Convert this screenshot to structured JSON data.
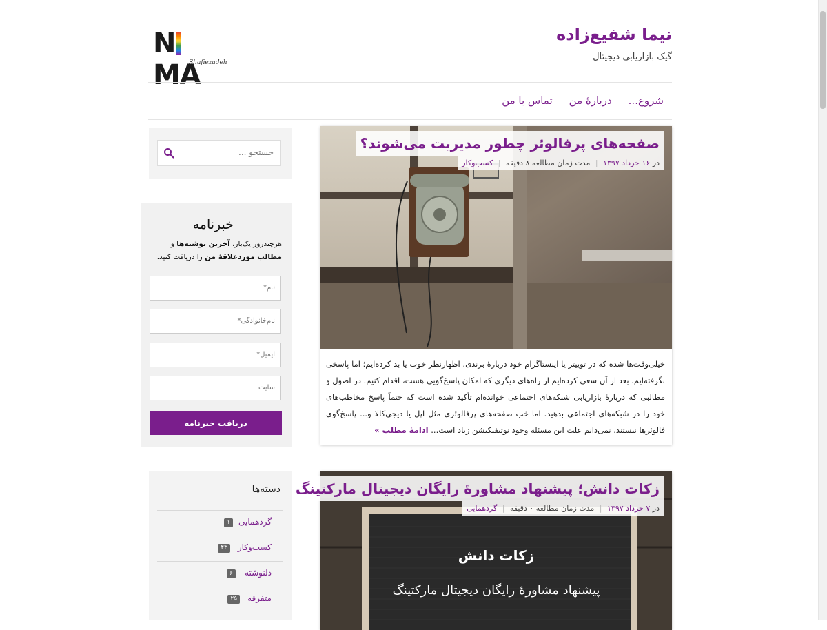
{
  "site": {
    "title": "نیما شفیع‌زاده",
    "tagline": "گیک بازاریابی دیجیتال",
    "logo_text": "NIMA",
    "logo_subtext": "Shafiezadeh"
  },
  "nav": {
    "items": [
      {
        "label": "شروع..."
      },
      {
        "label": "دربارهٔ من"
      },
      {
        "label": "تماس با من"
      }
    ]
  },
  "search": {
    "placeholder": "جستجو ..."
  },
  "newsletter": {
    "title": "خبرنامه",
    "text_before": "هرچندروز یک‌بار، ",
    "text_bold1": "آخرین نوشته‌ها",
    "text_mid": " و ",
    "text_bold2": "مطالب موردعلاقهٔ من",
    "text_after": " را دریافت کنید.",
    "fields": [
      {
        "placeholder": "نام*"
      },
      {
        "placeholder": "نام‌خانوادگی*"
      },
      {
        "placeholder": "ایمیل*"
      },
      {
        "placeholder": "سایت"
      }
    ],
    "button_label": "دریافت خبرنامه"
  },
  "categories": {
    "title": "دسته‌ها",
    "items": [
      {
        "name": "گردهمایی",
        "count": "۱"
      },
      {
        "name": "کسب‌وکار",
        "count": "۴۳"
      },
      {
        "name": "دلنوشته",
        "count": "۶"
      },
      {
        "name": "متفرقه",
        "count": "۲۵"
      }
    ]
  },
  "posts": [
    {
      "title": "صفحه‌های پرفالوئر چطور مدیریت می‌شوند؟",
      "date_prefix": "در",
      "date": "۱۶ خرداد ۱۳۹۷",
      "reading_time": "مدت زمان مطالعه ۸ دقیقه",
      "category": "کسب‌وکار",
      "excerpt": "خیلی‌وقت‌ها شده که در توییتر یا اینستاگرام خود دربارهٔ برندی، اظهارنظر خوب یا بد کرده‌ایم؛ اما پاسخی نگرفته‌ایم. بعد از آن سعی کرده‌ایم از راه‌های دیگری که امکان پاسخ‌گویی هست، اقدام کنیم. در اصول و مطالبی که دربارهٔ بازاریابی شبکه‌های اجتماعی خوانده‌ام تأکید شده است که حتماً پاسخ مخاطب‌های خود را در شبکه‌های اجتماعی بدهید. اما خب صفحه‌های پرفالوئری مثل اپل یا دیجی‌کالا و... پاسخ‌گوی فالوئرها نیستند. نمی‌دانم علت این مسئله وجود نوتیفیکیشن زیاد است...",
      "read_more": "ادامهٔ مطلب »"
    },
    {
      "title": "زکات دانش؛ پیشنهاد مشاورهٔ رایگان دیجیتال مارکتینگ",
      "date_prefix": "در",
      "date": "۷ خرداد ۱۳۹۷",
      "reading_time": "مدت زمان مطالعه ۰ دقیقه",
      "category": "گردهمایی",
      "image_text_line1": "زکات دانش",
      "image_text_line2": "پیشنهاد مشاورهٔ رایگان دیجیتال مارکتینگ"
    }
  ],
  "colors": {
    "accent": "#7a1e8c",
    "sidebar_bg": "#f3f3f3"
  }
}
